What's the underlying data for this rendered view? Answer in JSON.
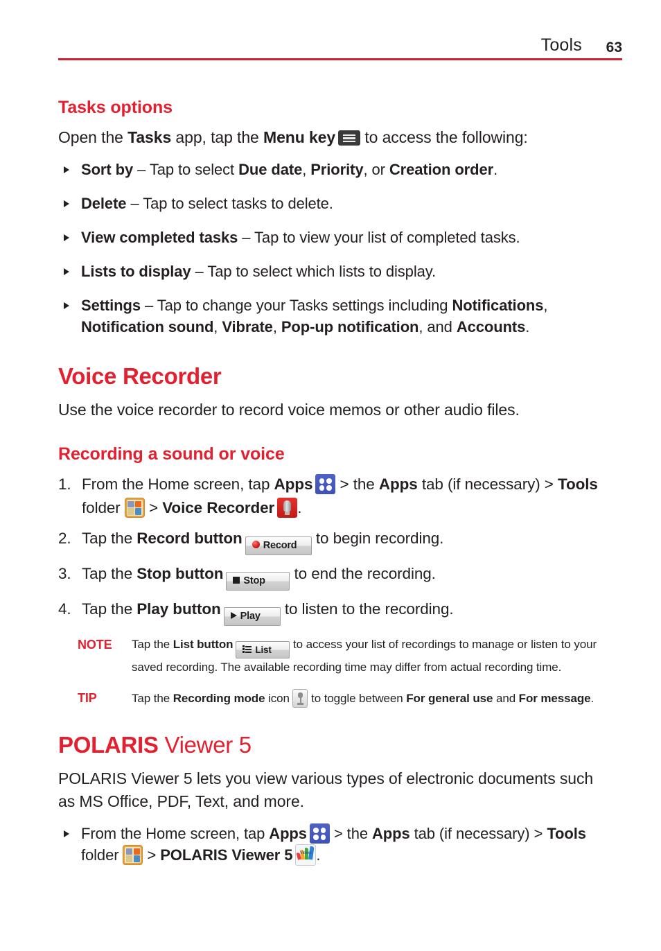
{
  "header": {
    "title": "Tools",
    "page_number": "63"
  },
  "tasks_options": {
    "heading": "Tasks options",
    "intro_a": "Open the ",
    "intro_tasks": "Tasks",
    "intro_b": " app, tap the ",
    "intro_menu_key": "Menu key",
    "intro_c": " to access the following:",
    "menu_key_icon": "menu-key-icon",
    "bullets": [
      {
        "term": "Sort by",
        "dash": " – ",
        "text_a": "Tap to select ",
        "em1": "Due date",
        "text_b": ", ",
        "em2": "Priority",
        "text_c": ", or ",
        "em3": "Creation order",
        "text_d": "."
      },
      {
        "term": "Delete",
        "dash": " – ",
        "text_a": "Tap to select tasks to delete."
      },
      {
        "term": "View completed tasks",
        "dash": " – ",
        "text_a": "Tap to view your list of completed tasks."
      },
      {
        "term": "Lists to display",
        "dash": " – ",
        "text_a": "Tap to select which lists to display."
      },
      {
        "term": "Settings",
        "dash": " – ",
        "text_a": "Tap to change your Tasks settings including ",
        "em1": "Notifications",
        "text_b": ", ",
        "em2": "Notification sound",
        "text_c": ", ",
        "em3": "Vibrate",
        "text_d": ", ",
        "em4": "Pop-up notification",
        "text_e": ", and ",
        "em5": "Accounts",
        "text_f": "."
      }
    ]
  },
  "voice_recorder": {
    "heading": "Voice Recorder",
    "intro": "Use the voice recorder to record voice memos or other audio files.",
    "sub_heading": "Recording a sound or voice",
    "steps": [
      {
        "num": "1.",
        "text_a": "From the Home screen, tap ",
        "em1": "Apps",
        "icon1": "apps-icon",
        "text_b": " > the ",
        "em2": "Apps",
        "text_c": " tab (if necessary) > ",
        "em3": "Tools",
        "text_d": " folder ",
        "icon2": "tools-folder-icon",
        "text_e": " > ",
        "em4": "Voice Recorder",
        "icon3": "voice-recorder-icon",
        "text_f": "."
      },
      {
        "num": "2.",
        "text_a": "Tap the ",
        "em1": "Record button",
        "button": "Record",
        "button_glyph": "record-circle-glyph",
        "text_b": " to begin recording."
      },
      {
        "num": "3.",
        "text_a": "Tap the ",
        "em1": "Stop button",
        "button": "Stop",
        "button_glyph": "stop-square-glyph",
        "text_b": " to end the recording."
      },
      {
        "num": "4.",
        "text_a": "Tap the ",
        "em1": "Play button",
        "button": "Play",
        "button_glyph": "play-triangle-glyph",
        "text_b": " to listen to the recording."
      }
    ],
    "note": {
      "tag": "NOTE",
      "text_a": "Tap the ",
      "em1": "List button",
      "button": "List",
      "button_glyph": "list-lines-glyph",
      "text_b": " to access your list of recordings to manage or listen to your saved recording. The available recording time may differ from actual recording time."
    },
    "tip": {
      "tag": "TIP",
      "text_a": "Tap the ",
      "em1": "Recording mode",
      "text_b": " icon ",
      "icon": "recording-mode-icon",
      "text_c": " to toggle between ",
      "em2": "For general use",
      "text_d": " and ",
      "em3": "For message",
      "text_e": "."
    }
  },
  "polaris": {
    "heading_bold": "POLARIS",
    "heading_light": " Viewer 5",
    "intro": "POLARIS Viewer 5 lets you view various types of electronic documents such as MS Office, PDF, Text, and more.",
    "bullet": {
      "text_a": "From the Home screen, tap ",
      "em1": "Apps",
      "icon1": "apps-icon",
      "text_b": " > the ",
      "em2": "Apps",
      "text_c": " tab (if necessary) > ",
      "em3": "Tools",
      "text_d": " folder ",
      "icon2": "tools-folder-icon",
      "text_e": " > ",
      "em4": "POLARIS Viewer 5",
      "icon3": "polaris-viewer-icon",
      "text_f": "."
    }
  },
  "colors": {
    "accent_red": "#e3202f",
    "rule_red": "#cf2030",
    "body_text": "#231f20"
  }
}
